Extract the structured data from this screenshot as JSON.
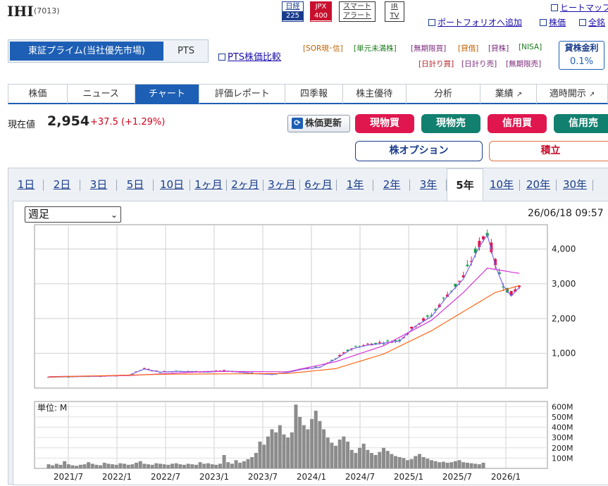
{
  "header": {
    "name": "IHI",
    "code": "(7013)",
    "badges": {
      "nikkei_top": "日経",
      "nikkei_bottom": "225",
      "jpx_top": "JPX",
      "jpx_bottom": "400",
      "alert_top": "スマート",
      "alert_bottom": "アラート",
      "irtv_top": "IR",
      "irtv_bottom": "TV"
    },
    "links": {
      "heatmap": "ヒートマップ",
      "portfolio": "ポートフォリオへ追加",
      "stock_price": "株価",
      "all": "全銘"
    }
  },
  "market": {
    "primary": "東証プライム(当社優先市場)",
    "pts": "PTS",
    "pts_compare": "PTS株価比較"
  },
  "tags": {
    "row1": [
      "[SOR現･信]",
      "[単元未満株]",
      "[無期限買]",
      "[貸借]",
      "[貸株]",
      "[NISA]"
    ],
    "row2": [
      "[日計り買]",
      "[日計り売]",
      "[無期限売]"
    ]
  },
  "lending": {
    "label": "貸株金利",
    "rate": "0.1%"
  },
  "nav": [
    "株価",
    "ニュース",
    "チャート",
    "評価レポート",
    "四季報",
    "株主優待",
    "分析",
    "業績",
    "適時開示"
  ],
  "price": {
    "label": "現在値",
    "value": "2,954",
    "change": "+37.5 (+1.29%)"
  },
  "buttons": {
    "refresh": "株価更新",
    "genbutsu_buy": "現物買",
    "genbutsu_sell": "現物売",
    "shinyo_buy": "信用買",
    "shinyo_sell": "信用売",
    "option": "株オプション",
    "tsumitate": "積立"
  },
  "periods": [
    "1日",
    "2日",
    "3日",
    "5日",
    "10日",
    "1ヶ月",
    "2ヶ月",
    "3ヶ月",
    "6ヶ月",
    "1年",
    "2年",
    "3年",
    "5年",
    "10年",
    "20年",
    "30年"
  ],
  "active_period": "5年",
  "chart_select": "週足",
  "chart_time": "26/06/18 09:57",
  "chart_data": {
    "type": "line",
    "price_axis": {
      "ticks": [
        1000,
        2000,
        3000,
        4000
      ],
      "tick_labels": [
        "1,000",
        "2,000",
        "3,000",
        "4,000"
      ],
      "ylim": [
        0,
        4700
      ]
    },
    "volume_axis": {
      "unit_label": "単位: M",
      "ticks": [
        100,
        200,
        300,
        400,
        500,
        600
      ],
      "tick_labels": [
        "100M",
        "200M",
        "300M",
        "400M",
        "500M",
        "600M"
      ],
      "ylim": [
        0,
        650
      ]
    },
    "x_labels": [
      "2021/7",
      "2022/1",
      "2022/7",
      "2023/1",
      "2023/7",
      "2024/1",
      "2024/7",
      "2025/1",
      "2025/7",
      "2026/1"
    ],
    "grid": true,
    "colors": {
      "up": "#e0174e",
      "down": "#1aa04a",
      "ma_short": "#7b68ee",
      "ma_mid": "#d633d6",
      "ma_long": "#ff6a1a",
      "volume": "#8c8c8c"
    },
    "price_points": [
      [
        0,
        320
      ],
      [
        4,
        330
      ],
      [
        8,
        340
      ],
      [
        12,
        345
      ],
      [
        16,
        360
      ],
      [
        20,
        370
      ],
      [
        24,
        560
      ],
      [
        28,
        470
      ],
      [
        32,
        490
      ],
      [
        36,
        480
      ],
      [
        40,
        470
      ],
      [
        44,
        500
      ],
      [
        48,
        470
      ],
      [
        52,
        420
      ],
      [
        56,
        400
      ],
      [
        60,
        460
      ],
      [
        64,
        560
      ],
      [
        68,
        610
      ],
      [
        72,
        850
      ],
      [
        76,
        1150
      ],
      [
        80,
        1260
      ],
      [
        84,
        1320
      ],
      [
        88,
        1380
      ],
      [
        92,
        1820
      ],
      [
        96,
        2100
      ],
      [
        100,
        2700
      ],
      [
        104,
        3200
      ],
      [
        108,
        4150
      ],
      [
        110,
        4500
      ],
      [
        112,
        3600
      ],
      [
        114,
        3000
      ],
      [
        116,
        2700
      ],
      [
        118,
        2954
      ]
    ],
    "series": [
      {
        "values_mid": [
          [
            0,
            330
          ],
          [
            20,
            360
          ],
          [
            40,
            480
          ],
          [
            60,
            470
          ],
          [
            72,
            760
          ],
          [
            84,
            1220
          ],
          [
            96,
            1950
          ],
          [
            104,
            2750
          ],
          [
            110,
            3450
          ],
          [
            118,
            3300
          ]
        ]
      },
      {
        "values_long": [
          [
            0,
            320
          ],
          [
            30,
            400
          ],
          [
            60,
            420
          ],
          [
            72,
            560
          ],
          [
            84,
            980
          ],
          [
            96,
            1650
          ],
          [
            104,
            2200
          ],
          [
            112,
            2750
          ],
          [
            118,
            2950
          ]
        ]
      }
    ],
    "volume": [
      40,
      30,
      45,
      35,
      70,
      40,
      30,
      25,
      35,
      40,
      60,
      45,
      35,
      30,
      55,
      45,
      40,
      35,
      50,
      45,
      35,
      40,
      55,
      70,
      45,
      40,
      35,
      50,
      45,
      40,
      35,
      45,
      50,
      40,
      35,
      45,
      40,
      35,
      60,
      45,
      50,
      40,
      35,
      45,
      130,
      60,
      45,
      80,
      55,
      70,
      90,
      110,
      150,
      260,
      230,
      310,
      380,
      350,
      420,
      330,
      300,
      350,
      620,
      500,
      420,
      380,
      480,
      560,
      460,
      380,
      300,
      250,
      220,
      280,
      310,
      260,
      180,
      150,
      200,
      240,
      180,
      150,
      130,
      160,
      200,
      170,
      140,
      120,
      110,
      100,
      80,
      90,
      120,
      140,
      110,
      95,
      80,
      70,
      60,
      65,
      55,
      60,
      70,
      80,
      60,
      55,
      50,
      45,
      40,
      55
    ]
  }
}
